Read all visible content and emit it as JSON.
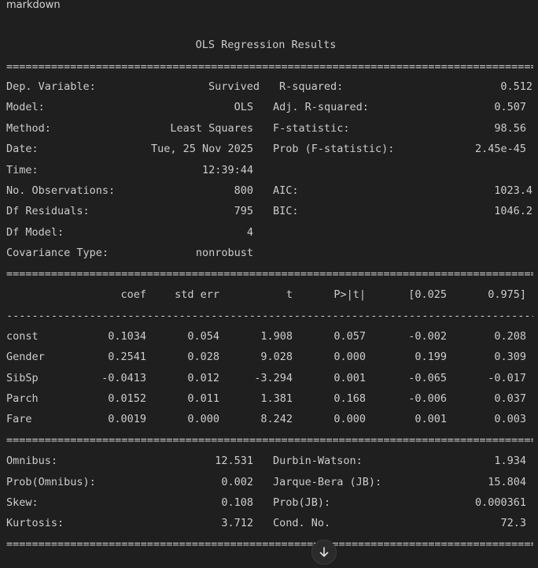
{
  "cell_type_label": "markdown",
  "title": "OLS Regression Results",
  "separators": {
    "double": "=================================================================================================",
    "single": "-------------------------------------------------------------------------------------------------"
  },
  "summary": {
    "left": [
      {
        "label": "Dep. Variable:",
        "value": "Survived"
      },
      {
        "label": "Model:",
        "value": "OLS"
      },
      {
        "label": "Method:",
        "value": "Least Squares"
      },
      {
        "label": "Date:",
        "value": "Tue, 25 Nov 2025"
      },
      {
        "label": "Time:",
        "value": "12:39:44"
      },
      {
        "label": "No. Observations:",
        "value": "800"
      },
      {
        "label": "Df Residuals:",
        "value": "795"
      },
      {
        "label": "Df Model:",
        "value": "4"
      },
      {
        "label": "Covariance Type:",
        "value": "nonrobust"
      }
    ],
    "right": [
      {
        "label": "R-squared:",
        "value": "0.512"
      },
      {
        "label": "Adj. R-squared:",
        "value": "0.507"
      },
      {
        "label": "F-statistic:",
        "value": "98.56"
      },
      {
        "label": "Prob (F-statistic):",
        "value": "2.45e-45"
      },
      {
        "label": "",
        "value": ""
      },
      {
        "label": "AIC:",
        "value": "1023.4"
      },
      {
        "label": "BIC:",
        "value": "1046.2"
      }
    ]
  },
  "coef_table": {
    "headers": [
      "coef",
      "std err",
      "t",
      "P>|t|",
      "[0.025",
      "0.975]"
    ],
    "rows": [
      {
        "name": "const",
        "values": [
          "0.1034",
          "0.054",
          "1.908",
          "0.057",
          "-0.002",
          "0.208"
        ]
      },
      {
        "name": "Gender",
        "values": [
          "0.2541",
          "0.028",
          "9.028",
          "0.000",
          "0.199",
          "0.309"
        ]
      },
      {
        "name": "SibSp",
        "values": [
          "-0.0413",
          "0.012",
          "-3.294",
          "0.001",
          "-0.065",
          "-0.017"
        ]
      },
      {
        "name": "Parch",
        "values": [
          "0.0152",
          "0.011",
          "1.381",
          "0.168",
          "-0.006",
          "0.037"
        ]
      },
      {
        "name": "Fare",
        "values": [
          "0.0019",
          "0.000",
          "8.242",
          "0.000",
          "0.001",
          "0.003"
        ]
      }
    ]
  },
  "diagnostics": {
    "left": [
      {
        "label": "Omnibus:",
        "value": "12.531"
      },
      {
        "label": "Prob(Omnibus):",
        "value": "0.002"
      },
      {
        "label": "Skew:",
        "value": "0.108"
      },
      {
        "label": "Kurtosis:",
        "value": "3.712"
      }
    ],
    "right": [
      {
        "label": "Durbin-Watson:",
        "value": "1.934"
      },
      {
        "label": "Jarque-Bera (JB):",
        "value": "15.804"
      },
      {
        "label": "Prob(JB):",
        "value": "0.000361"
      },
      {
        "label": "Cond. No.",
        "value": "72.3"
      }
    ]
  },
  "scroll_button_icon": "arrow-down-icon"
}
